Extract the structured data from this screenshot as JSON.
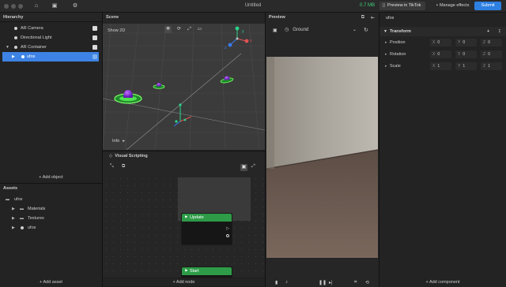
{
  "titlebar": {
    "title": "Untitled",
    "memory": "0.7 MB",
    "preview_tiktok_label": "Preview in TikTok",
    "manage_effects_label": "Manage effects",
    "submit_label": "Submit"
  },
  "hierarchy": {
    "title": "Hierarchy",
    "items": [
      {
        "label": "AR Camera"
      },
      {
        "label": "Directional Light"
      },
      {
        "label": "AR Container"
      },
      {
        "label": "ufos"
      }
    ],
    "add_object_label": "+ Add object"
  },
  "assets": {
    "title": "Assets",
    "root": "ufos",
    "items": [
      {
        "label": "Materials"
      },
      {
        "label": "Textures"
      },
      {
        "label": "ufos"
      }
    ],
    "add_asset_label": "+ Add asset"
  },
  "scene": {
    "title": "Scene",
    "show2d_label": "Show 2D",
    "info_label": "Info",
    "gizmo_x": "x",
    "gizmo_y": "y",
    "gizmo_z": "z"
  },
  "visual_scripting": {
    "title": "Visual Scripting",
    "nodes": [
      {
        "label": "Update"
      },
      {
        "label": "Start"
      }
    ],
    "add_node_label": "+ Add node"
  },
  "preview": {
    "title": "Preview",
    "background": "Ground"
  },
  "inspector": {
    "object_name": "ufos",
    "section": "Transform",
    "position": {
      "label": "Position",
      "x": "0",
      "y": "0",
      "z": "0"
    },
    "rotation": {
      "label": "Rotation",
      "x": "0",
      "y": "0",
      "z": "0"
    },
    "scale": {
      "label": "Scale",
      "x": "1",
      "y": "1",
      "z": "1"
    },
    "add_component_label": "+ Add component"
  },
  "colors": {
    "accent": "#3d83e5",
    "submit": "#2d7fe0",
    "node_green": "#2d9b47",
    "memory_green": "#43d17b"
  }
}
